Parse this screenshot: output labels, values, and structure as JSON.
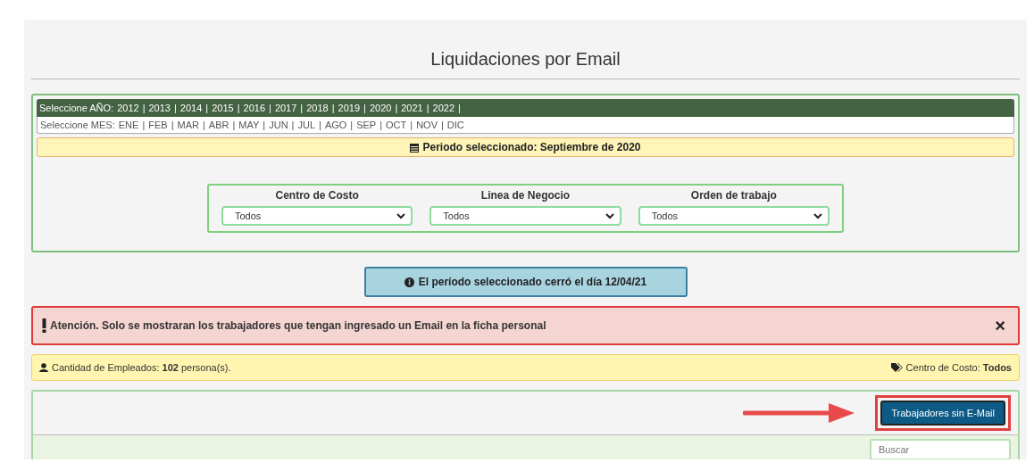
{
  "title": "Liquidaciones por Email",
  "year_selector": {
    "label": "Seleccione AÑO:",
    "separator": "|",
    "years": [
      "2012",
      "2013",
      "2014",
      "2015",
      "2016",
      "2017",
      "2018",
      "2019",
      "2020",
      "2021",
      "2022"
    ]
  },
  "month_selector": {
    "label": "Seleccione MES:",
    "separator": "|",
    "months": [
      "ENE",
      "FEB",
      "MAR",
      "ABR",
      "MAY",
      "JUN",
      "JUL",
      "AGO",
      "SEP",
      "OCT",
      "NOV",
      "DIC"
    ]
  },
  "period_banner": "Periodo seleccionado: Septiembre de 2020",
  "filters": [
    {
      "label": "Centro de Costo",
      "value": "Todos"
    },
    {
      "label": "Linea de Negocio",
      "value": "Todos"
    },
    {
      "label": "Orden de trabajo",
      "value": "Todos"
    }
  ],
  "closed_notice": "El período seleccionado cerró el día 12/04/21",
  "alert": {
    "text": "Atención. Solo se mostraran los trabajadores que tengan ingresado un Email en la ficha personal",
    "close": "×"
  },
  "summary": {
    "employees_label": "Cantidad de Empleados: ",
    "employees_count": "102",
    "employees_unit": " persona(s).",
    "cost_center_label": "Centro de Costo: ",
    "cost_center_value": "Todos"
  },
  "toolbar": {
    "button": "Trabajadores sin E-Mail",
    "highlighted": true
  },
  "search": {
    "placeholder": "Buscar"
  }
}
